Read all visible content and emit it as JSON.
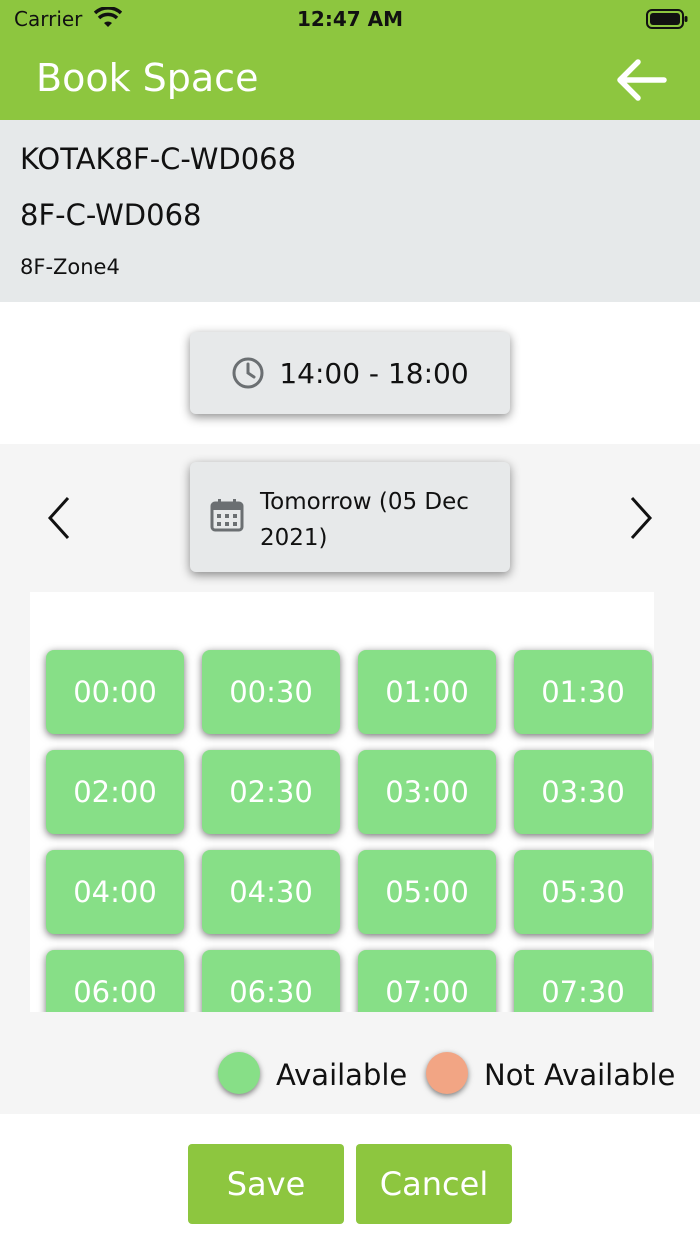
{
  "status_bar": {
    "carrier": "Carrier",
    "time": "12:47 AM"
  },
  "header": {
    "title": "Book Space",
    "back_icon": "arrow-left-icon"
  },
  "space": {
    "code": "KOTAK8F-C-WD068",
    "desk": "8F-C-WD068",
    "zone": "8F-Zone4"
  },
  "time_range": {
    "label": "14:00 - 18:00",
    "icon": "clock-icon"
  },
  "date": {
    "label": "Tomorrow (05 Dec 2021)",
    "icon": "calendar-icon"
  },
  "slots": [
    "00:00",
    "00:30",
    "01:00",
    "01:30",
    "02:00",
    "02:30",
    "03:00",
    "03:30",
    "04:00",
    "04:30",
    "05:00",
    "05:30",
    "06:00",
    "06:30",
    "07:00",
    "07:30"
  ],
  "legend": {
    "available": "Available",
    "not_available": "Not Available"
  },
  "actions": {
    "save": "Save",
    "cancel": "Cancel"
  },
  "colors": {
    "brand": "#8dc63f",
    "available": "#87df87",
    "not_available": "#f2a584"
  }
}
